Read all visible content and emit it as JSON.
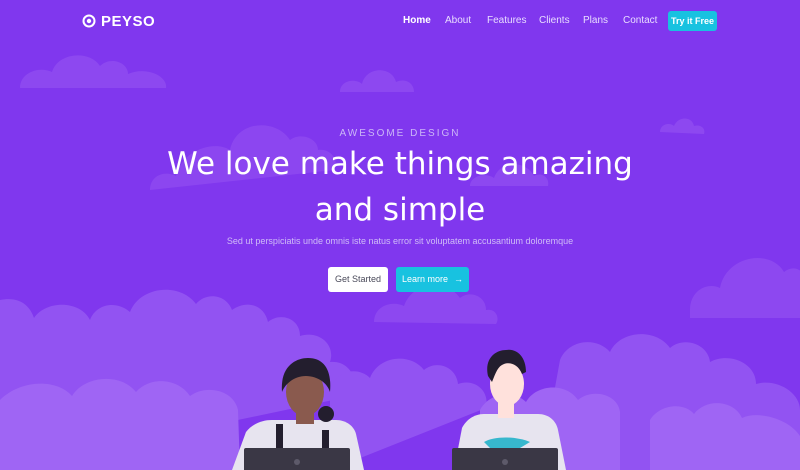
{
  "brand": {
    "name": "PEYSO",
    "icon": "target-ring-icon"
  },
  "nav": {
    "items": [
      {
        "label": "Home",
        "active": true
      },
      {
        "label": "About",
        "active": false
      },
      {
        "label": "Features",
        "active": false
      },
      {
        "label": "Clients",
        "active": false
      },
      {
        "label": "Plans",
        "active": false
      },
      {
        "label": "Contact",
        "active": false
      }
    ],
    "cta_label": "Try it Free"
  },
  "hero": {
    "eyebrow": "AWESOME DESIGN",
    "headline_line1": "We love make things amazing",
    "headline_line2": "and simple",
    "subtitle": "Sed ut perspiciatis unde omnis iste natus error sit voluptatem accusantium doloremque",
    "primary_button": "Get Started",
    "secondary_button": "Learn more",
    "secondary_icon": "arrow-right-icon"
  },
  "colors": {
    "background": "#8037ee",
    "accent": "#18c2e0",
    "cloud": "#9352f2",
    "cloud_light": "#a46af5"
  }
}
